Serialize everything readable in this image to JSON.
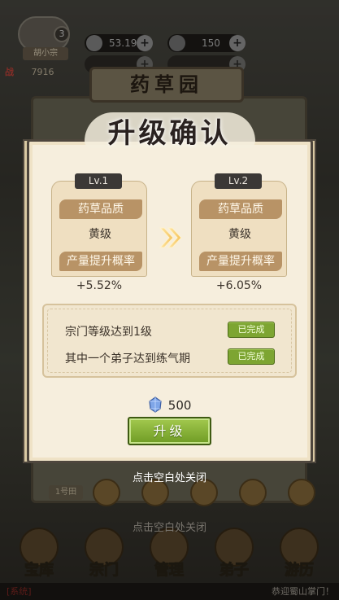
{
  "hud": {
    "player_level": "3",
    "sect_name": "胡小宗",
    "currency_1": "53.19w",
    "currency_2": "150",
    "war_label": "战",
    "war_value": "7916"
  },
  "building_title": "药草园",
  "modal": {
    "title": "升级确认",
    "current": {
      "level": "Lv.1",
      "quality_label": "药草品质",
      "quality_value": "黄级",
      "rate_label": "产量提升概率",
      "rate_value": "+5.52%"
    },
    "next": {
      "level": "Lv.2",
      "quality_label": "药草品质",
      "quality_value": "黄级",
      "rate_label": "产量提升概率",
      "rate_value": "+6.05%"
    },
    "conditions": [
      {
        "text": "宗门等级达到1级",
        "status": "已完成"
      },
      {
        "text": "其中一个弟子达到练气期",
        "status": "已完成"
      }
    ],
    "cost_value": "500",
    "upgrade_label": "升级",
    "close_hint": "点击空白处关闭"
  },
  "background": {
    "slot_label": "1号田",
    "close_hint": "点击空白处关闭"
  },
  "nav": [
    {
      "label": "宝库"
    },
    {
      "label": "宗门"
    },
    {
      "label": "管理"
    },
    {
      "label": "弟子"
    },
    {
      "label": "游历"
    }
  ],
  "sysbar": {
    "tag": "[系统]",
    "message": "恭迎蜀山掌门！"
  },
  "colors": {
    "accent_green": "#7da532",
    "chip_brown": "#b89366",
    "parchment": "#f6eedd"
  }
}
